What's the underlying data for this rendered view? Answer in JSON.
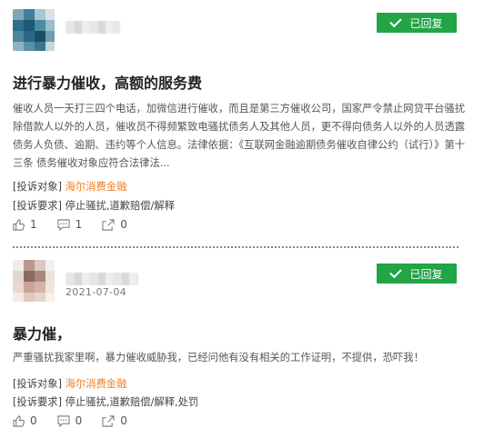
{
  "colors": {
    "badge_green": "#22a447",
    "link_orange": "#ef7d22"
  },
  "posts": [
    {
      "date": "",
      "status": "已回复",
      "title": "进行暴力催收，高额的服务费",
      "content": "催收人员一天打三四个电话，加微信进行催收，而且是第三方催收公司，国家严令禁止网贷平台骚扰除借款人以外的人员，催收员不得频繁致电骚扰债务人及其他人员，更不得向债务人以外的人员透露债务人负债、逾期、违约等个人信息。法律依据：《互联网金融逾期债务催收自律公约（试行）》第十三条 债务催收对象应符合法律法...",
      "target_label": "[投诉对象]",
      "target_value": "海尔消费金融",
      "demand_label": "[投诉要求]",
      "demand_value": "停止骚扰,道歉赔偿/解释",
      "likes": "1",
      "comments": "1",
      "shares": "0"
    },
    {
      "date": "2021-07-04",
      "status": "已回复",
      "title": "暴力催，",
      "content": "严重骚扰我家里啊，暴力催收威胁我，已经问他有没有相关的工作证明，不提供，恐吓我！",
      "target_label": "[投诉对象]",
      "target_value": "海尔消费金融",
      "demand_label": "[投诉要求]",
      "demand_value": "停止骚扰,道歉赔偿/解释,处罚",
      "likes": "0",
      "comments": "0",
      "shares": "0"
    }
  ],
  "icons": {
    "like": "thumbs-up-icon",
    "comment": "comment-icon",
    "share": "share-icon",
    "check": "check-icon"
  }
}
